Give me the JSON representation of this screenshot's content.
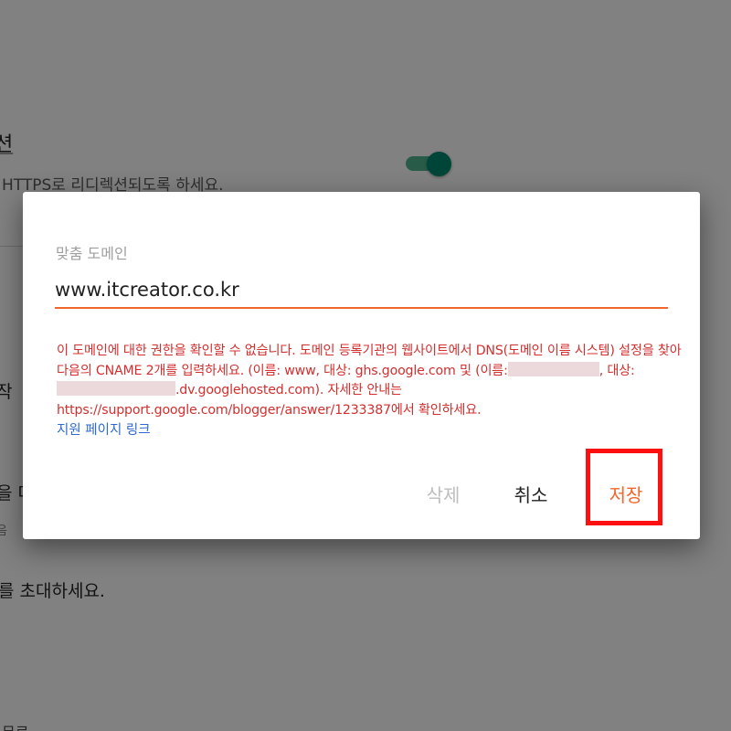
{
  "background": {
    "setting_title": "션",
    "setting_desc": "HTTPS로 리디렉션되도록 하세요.",
    "item1_fragment": "작",
    "item2_fragment": "을 다",
    "item2_sub_fragment": "음",
    "invite_text": "를 초대하세요.",
    "bottom_fragment": "무료",
    "toggle_state": "on"
  },
  "dialog": {
    "field_label": "맞춤 도메인",
    "field_value": "www.itcreator.co.kr",
    "error": {
      "part1": "이 도메인에 대한 권한을 확인할 수 없습니다. 도메인 등록기관의 웹사이트에서 DNS(도메인 이름 시스템) 설정을 찾아 다음의 CNAME 2개를 입력하세요. (이름: www, 대상: ghs.google.com 및 (이름:",
      "part2": ", 대상:",
      "part3": ".dv.googlehosted.com). 자세한 안내는 https://support.google.com/blogger/answer/1233387에서 확인하세요."
    },
    "support_link": "지원 페이지 링크",
    "buttons": {
      "delete": "삭제",
      "cancel": "취소",
      "save": "저장"
    }
  },
  "colors": {
    "accent": "#f1662b",
    "error": "#d32f2f",
    "link": "#2e6ad1",
    "toggle": "#00856a",
    "highlight": "#ff1010"
  }
}
